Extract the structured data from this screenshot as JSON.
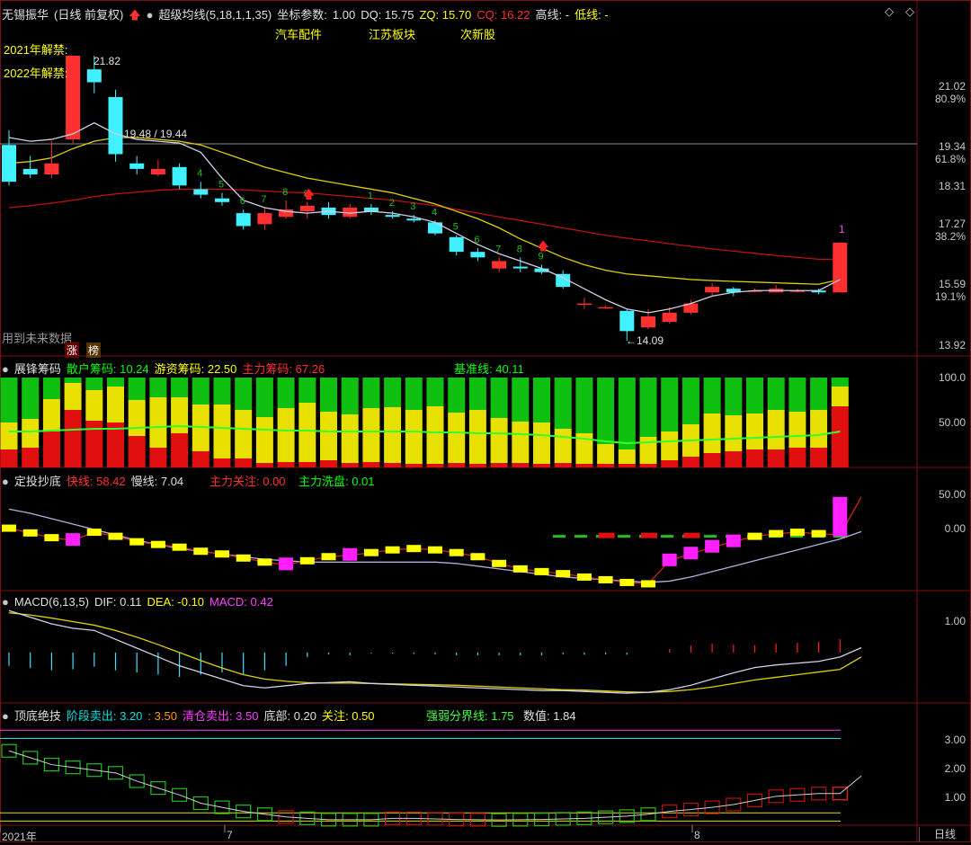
{
  "main_header": {
    "stock": "无锡振华",
    "period": "(日线 前复权)",
    "indicator": "超级均线(5,18,1,1,35)",
    "coord_label": "坐标参数:",
    "coord_value": "1.00",
    "dq": "DQ: 15.75",
    "zq": "ZQ: 15.70",
    "cq": "CQ: 16.22",
    "high": "高线: -",
    "low": "低线: -"
  },
  "concepts": [
    "汽车配件",
    "江苏板块",
    "次新股"
  ],
  "unlock_notes": [
    "2021年解禁:",
    "2022年解禁:"
  ],
  "future_note": "用到未来数据",
  "badges": [
    "涨",
    "榜"
  ],
  "annotations": {
    "high": "21.82",
    "mid": "19.48 / 19.44",
    "low": "←14.09",
    "signal_1": "1"
  },
  "count_labels": [
    "4",
    "5",
    "6",
    "7",
    "8",
    "9",
    "1",
    "2",
    "3",
    "4",
    "5",
    "6",
    "7",
    "8",
    "9"
  ],
  "price_axis": [
    "21.02",
    "80.9%",
    "19.34",
    "61.8%",
    "18.31",
    "17.27",
    "38.2%",
    "15.59",
    "19.1%",
    "13.92"
  ],
  "chip_header": {
    "name": "展锋筹码",
    "retail": "散户筹码: 10.24",
    "hot": "游资筹码: 22.50",
    "main": "主力筹码: 67.26",
    "base": "基准线: 40.11"
  },
  "chip_axis": [
    "100.0",
    "50.00"
  ],
  "dingtou_header": {
    "name": "定投抄底",
    "fast": "快线: 58.42",
    "slow": "慢线: 7.04",
    "focus": "主力关注: 0.00",
    "wash": "主力洗盘: 0.01"
  },
  "dingtou_axis": [
    "50.00",
    "0.00"
  ],
  "macd_header": {
    "name": "MACD(6,13,5)",
    "dif": "DIF: 0.11",
    "dea": "DEA: -0.10",
    "macd": "MACD: 0.42"
  },
  "macd_axis": [
    "1.00"
  ],
  "top_header": {
    "name": "顶底绝技",
    "stage_sell": "阶段卖出: 3.20",
    "v350": ": 3.50",
    "clear": "清仓卖出: 3.50",
    "bottom": "底部: 0.20",
    "watch": "关注: 0.50",
    "strength": "强弱分界线: 1.75",
    "value": "数值: 1.84"
  },
  "top_axis": [
    "3.00",
    "2.00",
    "1.00"
  ],
  "date_axis": [
    "2021年",
    "7",
    "8"
  ],
  "period_button": "日线",
  "colors": {
    "up": "#ff3030",
    "down": "#40f0ff",
    "ma_white": "#d0d0e8",
    "ma_yellow": "#e0d000",
    "ma_red": "#c01010"
  },
  "chart_data": {
    "type": "candlestick",
    "candles": [
      [
        19.4,
        18.4,
        19.8,
        18.3
      ],
      [
        18.75,
        18.6,
        19.1,
        18.5
      ],
      [
        18.6,
        18.9,
        19.5,
        18.5
      ],
      [
        19.55,
        21.82,
        21.82,
        19.45
      ],
      [
        21.45,
        21.1,
        21.82,
        20.8
      ],
      [
        20.7,
        19.15,
        20.9,
        18.95
      ],
      [
        18.9,
        18.75,
        19.1,
        18.6
      ],
      [
        18.6,
        18.75,
        19.0,
        18.55
      ],
      [
        18.8,
        18.3,
        18.9,
        18.2
      ],
      [
        18.2,
        18.05,
        18.4,
        17.95
      ],
      [
        17.95,
        17.85,
        18.1,
        17.75
      ],
      [
        17.55,
        17.2,
        17.65,
        17.1
      ],
      [
        17.25,
        17.55,
        17.7,
        17.1
      ],
      [
        17.45,
        17.65,
        17.9,
        17.4
      ],
      [
        17.6,
        17.75,
        17.85,
        17.4
      ],
      [
        17.7,
        17.5,
        17.85,
        17.4
      ],
      [
        17.45,
        17.7,
        17.8,
        17.4
      ],
      [
        17.7,
        17.6,
        17.8,
        17.5
      ],
      [
        17.5,
        17.45,
        17.6,
        17.4
      ],
      [
        17.4,
        17.35,
        17.5,
        17.3
      ],
      [
        17.3,
        17.0,
        17.35,
        16.95
      ],
      [
        16.9,
        16.5,
        16.95,
        16.4
      ],
      [
        16.5,
        16.35,
        16.6,
        16.25
      ],
      [
        16.05,
        16.25,
        16.35,
        15.95
      ],
      [
        16.1,
        16.05,
        16.35,
        15.95
      ],
      [
        16.05,
        15.95,
        16.15,
        15.9
      ],
      [
        15.9,
        15.55,
        16.0,
        15.5
      ],
      [
        15.1,
        15.1,
        15.25,
        14.95
      ],
      [
        15.0,
        15.0,
        15.05,
        14.95
      ],
      [
        14.9,
        14.35,
        14.95,
        14.09
      ],
      [
        14.45,
        14.75,
        14.95,
        14.4
      ],
      [
        14.6,
        14.85,
        15.0,
        14.55
      ],
      [
        14.85,
        15.1,
        15.2,
        14.8
      ],
      [
        15.4,
        15.55,
        15.65,
        15.3
      ],
      [
        15.5,
        15.4,
        15.55,
        15.3
      ],
      [
        15.45,
        15.45,
        15.5,
        15.4
      ],
      [
        15.4,
        15.5,
        15.6,
        15.4
      ],
      [
        15.45,
        15.45,
        15.5,
        15.4
      ],
      [
        15.45,
        15.4,
        15.5,
        15.35
      ],
      [
        15.4,
        16.75,
        16.75,
        15.4
      ]
    ],
    "ma_white": [
      19.6,
      19.5,
      19.55,
      19.7,
      20.0,
      19.7,
      19.55,
      19.5,
      19.45,
      19.2,
      18.5,
      17.9,
      17.7,
      17.6,
      17.55,
      17.6,
      17.55,
      17.6,
      17.55,
      17.45,
      17.3,
      17.0,
      16.7,
      16.45,
      16.25,
      16.05,
      15.8,
      15.5,
      15.2,
      14.95,
      14.85,
      14.95,
      15.1,
      15.3,
      15.4,
      15.45,
      15.45,
      15.45,
      15.45,
      15.75
    ],
    "ma_yellow": [
      18.9,
      18.95,
      19.05,
      19.3,
      19.5,
      19.6,
      19.6,
      19.55,
      19.5,
      19.4,
      19.2,
      19.0,
      18.8,
      18.65,
      18.5,
      18.4,
      18.3,
      18.2,
      18.1,
      17.95,
      17.8,
      17.6,
      17.4,
      17.15,
      16.85,
      16.6,
      16.35,
      16.15,
      16.0,
      15.9,
      15.85,
      15.8,
      15.75,
      15.72,
      15.7,
      15.68,
      15.66,
      15.64,
      15.62,
      15.75
    ],
    "ma_red": [
      17.7,
      17.75,
      17.82,
      17.9,
      18.0,
      18.07,
      18.12,
      18.17,
      18.2,
      18.2,
      18.2,
      18.18,
      18.15,
      18.12,
      18.1,
      18.05,
      18.0,
      17.95,
      17.9,
      17.83,
      17.75,
      17.65,
      17.55,
      17.45,
      17.35,
      17.25,
      17.15,
      17.05,
      16.95,
      16.87,
      16.8,
      16.72,
      16.65,
      16.58,
      16.52,
      16.46,
      16.4,
      16.35,
      16.3,
      16.3
    ],
    "price_range": [
      13.7,
      22.6
    ],
    "chip_bars": [
      [
        20,
        30,
        50
      ],
      [
        22,
        32,
        46
      ],
      [
        40,
        36,
        24
      ],
      [
        64,
        30,
        6
      ],
      [
        52,
        34,
        14
      ],
      [
        50,
        40,
        10
      ],
      [
        35,
        40,
        25
      ],
      [
        22,
        56,
        22
      ],
      [
        38,
        40,
        22
      ],
      [
        18,
        52,
        30
      ],
      [
        10,
        60,
        30
      ],
      [
        10,
        54,
        36
      ],
      [
        5,
        51,
        44
      ],
      [
        6,
        60,
        34
      ],
      [
        6,
        66,
        28
      ],
      [
        8,
        54,
        38
      ],
      [
        5,
        54,
        41
      ],
      [
        6,
        60,
        34
      ],
      [
        5,
        62,
        33
      ],
      [
        4,
        60,
        36
      ],
      [
        4,
        64,
        32
      ],
      [
        5,
        56,
        39
      ],
      [
        4,
        60,
        36
      ],
      [
        5,
        50,
        45
      ],
      [
        5,
        46,
        49
      ],
      [
        4,
        46,
        50
      ],
      [
        5,
        38,
        57
      ],
      [
        4,
        34,
        62
      ],
      [
        4,
        22,
        74
      ],
      [
        4,
        16,
        80
      ],
      [
        4,
        30,
        66
      ],
      [
        8,
        32,
        60
      ],
      [
        12,
        36,
        52
      ],
      [
        16,
        44,
        40
      ],
      [
        18,
        40,
        42
      ],
      [
        20,
        40,
        40
      ],
      [
        20,
        44,
        36
      ],
      [
        22,
        40,
        38
      ],
      [
        22,
        42,
        36
      ],
      [
        68,
        22,
        10
      ]
    ],
    "chip_base": [
      40,
      40,
      41,
      42,
      43,
      43,
      44,
      45,
      46,
      45,
      44,
      43,
      42,
      41,
      41,
      40,
      40,
      40,
      40,
      40,
      39,
      39,
      38,
      38,
      37,
      36,
      34,
      32,
      29,
      27,
      28,
      29,
      30,
      31,
      32,
      33,
      34,
      35,
      36,
      40
    ],
    "dingtou_fast": [
      12,
      5,
      -2,
      -6,
      6,
      0,
      -8,
      -12,
      -16,
      -22,
      -26,
      -32,
      -38,
      -42,
      -36,
      -30,
      -28,
      -24,
      -20,
      -18,
      -20,
      -24,
      -30,
      -40,
      -48,
      -52,
      -55,
      -60,
      -64,
      -68,
      -70,
      -36,
      -26,
      -16,
      -8,
      0,
      4,
      6,
      4,
      2,
      58
    ],
    "dingtou_slow": [
      40,
      34,
      26,
      18,
      10,
      2,
      -6,
      -12,
      -18,
      -22,
      -26,
      -30,
      -34,
      -36,
      -38,
      -38,
      -38,
      -38,
      -38,
      -38,
      -38,
      -40,
      -44,
      -48,
      -52,
      -56,
      -60,
      -62,
      -64,
      -66,
      -68,
      -66,
      -60,
      -52,
      -44,
      -36,
      -28,
      -20,
      -12,
      -4,
      7
    ],
    "dingtou_range": [
      -80,
      75
    ],
    "macd_dif": [
      0.95,
      0.8,
      0.65,
      0.55,
      0.5,
      0.3,
      0.1,
      -0.1,
      -0.3,
      -0.45,
      -0.6,
      -0.75,
      -0.8,
      -0.75,
      -0.7,
      -0.68,
      -0.66,
      -0.7,
      -0.72,
      -0.74,
      -0.76,
      -0.78,
      -0.8,
      -0.82,
      -0.84,
      -0.86,
      -0.86,
      -0.88,
      -0.9,
      -0.92,
      -0.9,
      -0.84,
      -0.74,
      -0.6,
      -0.46,
      -0.34,
      -0.28,
      -0.24,
      -0.2,
      -0.1,
      0.11
    ],
    "macd_dea": [
      0.9,
      0.85,
      0.78,
      0.7,
      0.62,
      0.5,
      0.35,
      0.18,
      0.0,
      -0.18,
      -0.35,
      -0.5,
      -0.6,
      -0.65,
      -0.68,
      -0.69,
      -0.69,
      -0.7,
      -0.71,
      -0.72,
      -0.73,
      -0.74,
      -0.76,
      -0.78,
      -0.8,
      -0.82,
      -0.84,
      -0.85,
      -0.87,
      -0.89,
      -0.9,
      -0.88,
      -0.84,
      -0.78,
      -0.7,
      -0.62,
      -0.56,
      -0.5,
      -0.44,
      -0.38,
      -0.1
    ],
    "macd_hist": [
      -0.3,
      -0.35,
      -0.4,
      -0.38,
      -0.32,
      -0.4,
      -0.45,
      -0.5,
      -0.55,
      -0.5,
      -0.45,
      -0.5,
      -0.4,
      -0.3,
      -0.1,
      -0.04,
      -0.06,
      -0.02,
      -0.02,
      -0.03,
      -0.04,
      -0.06,
      -0.06,
      -0.06,
      -0.06,
      -0.06,
      -0.04,
      -0.05,
      -0.04,
      -0.05,
      0,
      0.08,
      0.16,
      0.2,
      0.18,
      0.16,
      0.2,
      0.22,
      0.24,
      0.3,
      0.42
    ],
    "macd_range": [
      -1.1,
      1.3
    ],
    "top_line": [
      2.75,
      2.5,
      2.25,
      2.15,
      2.05,
      1.95,
      1.65,
      1.4,
      1.15,
      0.85,
      0.7,
      0.55,
      0.45,
      0.35,
      0.3,
      0.25,
      0.25,
      0.25,
      0.3,
      0.3,
      0.28,
      0.26,
      0.25,
      0.24,
      0.25,
      0.26,
      0.28,
      0.3,
      0.34,
      0.38,
      0.45,
      0.55,
      0.62,
      0.7,
      0.8,
      0.95,
      1.1,
      1.15,
      1.2,
      1.2,
      1.84
    ],
    "top_range": [
      0.05,
      3.9
    ],
    "top_levels": {
      "clear": 3.5,
      "stage": 3.2,
      "watch": 0.5,
      "bottom": 0.2
    }
  }
}
